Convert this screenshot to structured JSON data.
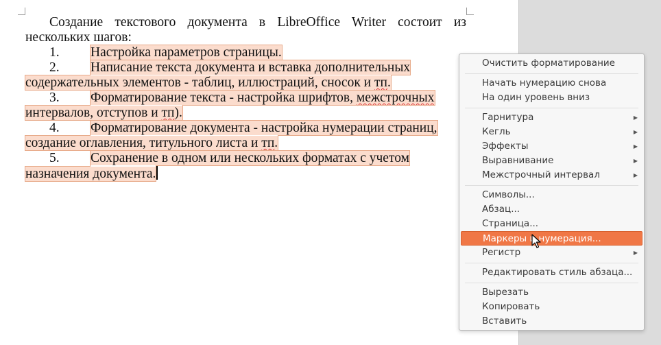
{
  "document": {
    "intro": "Создание текстового документа в LibreOffice Writer состоит из нескольких шагов:",
    "list": [
      {
        "num": "1.",
        "parts": [
          {
            "t": "Настройка параметров страницы."
          }
        ]
      },
      {
        "num": "2.",
        "parts": [
          {
            "t": "Написание текста документа и вставка дополнительных содержательных элементов - таблиц, иллюстраций, сносок и "
          },
          {
            "t": "тп",
            "wavy": true
          },
          {
            "t": "."
          }
        ]
      },
      {
        "num": "3.",
        "parts": [
          {
            "t": "Форматирование текста - настройка шрифтов, "
          },
          {
            "t": "межстрочных",
            "wavy": true
          },
          {
            "t": " интервалов, отступов и "
          },
          {
            "t": "тп",
            "wavy": true
          },
          {
            "t": ")."
          }
        ]
      },
      {
        "num": "4.",
        "parts": [
          {
            "t": "Форматирование документа - настройка нумерации страниц, создание оглавления, титульного листа и "
          },
          {
            "t": "тп",
            "wavy": true
          },
          {
            "t": "."
          }
        ]
      },
      {
        "num": "5.",
        "parts": [
          {
            "t": "Сохранение в одном или нескольких форматах с учетом назначения документа."
          }
        ]
      }
    ]
  },
  "context_menu": {
    "highlight_color": "#f07746",
    "items": [
      {
        "label": "Очистить форматирование",
        "name": "menu-clear-formatting"
      },
      {
        "sep": true
      },
      {
        "label": "Начать нумерацию снова",
        "name": "menu-restart-numbering"
      },
      {
        "label": "На один уровень вниз",
        "name": "menu-demote-level"
      },
      {
        "sep": true
      },
      {
        "label": "Гарнитура",
        "name": "menu-font",
        "submenu": true
      },
      {
        "label": "Кегль",
        "name": "menu-size",
        "submenu": true
      },
      {
        "label": "Эффекты",
        "name": "menu-effects",
        "submenu": true
      },
      {
        "label": "Выравнивание",
        "name": "menu-alignment",
        "submenu": true
      },
      {
        "label": "Межстрочный интервал",
        "name": "menu-line-spacing",
        "submenu": true
      },
      {
        "sep": true
      },
      {
        "label": "Символы...",
        "name": "menu-character"
      },
      {
        "label": "Абзац...",
        "name": "menu-paragraph"
      },
      {
        "label": "Страница...",
        "name": "menu-page"
      },
      {
        "label": "Маркеры и нумерация...",
        "name": "menu-bullets-numbering",
        "highlighted": true
      },
      {
        "label": "Регистр",
        "name": "menu-case",
        "submenu": true
      },
      {
        "sep": true
      },
      {
        "label": "Редактировать стиль абзаца...",
        "name": "menu-edit-paragraph-style"
      },
      {
        "sep": true
      },
      {
        "label": "Вырезать",
        "name": "menu-cut"
      },
      {
        "label": "Копировать",
        "name": "menu-copy"
      },
      {
        "label": "Вставить",
        "name": "menu-paste"
      }
    ]
  },
  "icons": {
    "submenu": "triangle-right-icon",
    "pointer": "mouse-pointer-icon"
  }
}
